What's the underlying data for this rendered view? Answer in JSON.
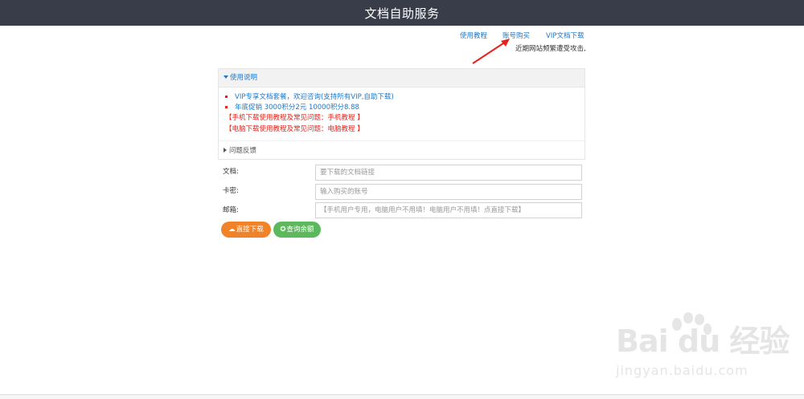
{
  "header": {
    "title": "文档自助服务"
  },
  "toplinks": {
    "tutorial": "使用教程",
    "buy": "账号购买",
    "vip": "VIP文档下载"
  },
  "notice": "近期网站频繁遭受攻击,",
  "panel": {
    "title": "使用说明",
    "items": [
      "VIP专享文档套餐，欢迎咨询(支持所有VIP,自助下载)",
      "年底促销 3000积分2元 10000积分8.88"
    ],
    "red_lines": [
      "【手机下载使用教程及常见问题：手机教程 】",
      "【电脑下载使用教程及常见问题：电脑教程 】"
    ],
    "footer": "问题反馈"
  },
  "form": {
    "doc_label": "文档:",
    "doc_placeholder": "要下载的文档链接",
    "card_label": "卡密:",
    "card_placeholder": "输入购买的账号",
    "email_label": "邮箱:",
    "email_placeholder": "【手机用户专用，电脑用户不用填！电脑用户不用填！点直接下载】"
  },
  "buttons": {
    "download": "直接下载",
    "balance": "查询余额"
  },
  "watermark": {
    "brand": "Bai du 经验",
    "url": "jingyan.baidu.com"
  },
  "colors": {
    "topbar": "#393d49",
    "link": "#1e78c8",
    "red": "#e4241b",
    "orange": "#f0832a",
    "green": "#5cb85c"
  }
}
